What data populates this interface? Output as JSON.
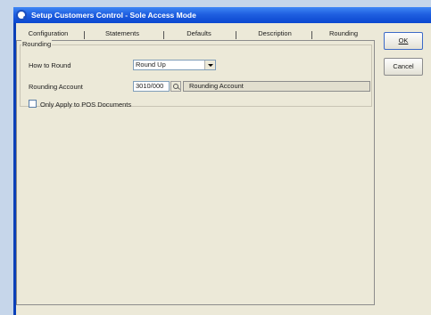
{
  "window": {
    "title": "Setup Customers Control - Sole Access Mode"
  },
  "tabs": [
    {
      "label": "Configuration"
    },
    {
      "label": "Statements"
    },
    {
      "label": "Defaults"
    },
    {
      "label": "Description"
    },
    {
      "label": "Rounding",
      "active": true
    }
  ],
  "rounding": {
    "group_label": "Rounding",
    "how_to_round_label": "How to Round",
    "how_to_round_value": "Round Up",
    "account_label": "Rounding Account",
    "account_value": "3010/000",
    "account_description": "Rounding Account",
    "pos_only_label": "Only Apply to POS Documents",
    "pos_only_checked": false
  },
  "buttons": {
    "ok": "OK",
    "cancel": "Cancel"
  }
}
